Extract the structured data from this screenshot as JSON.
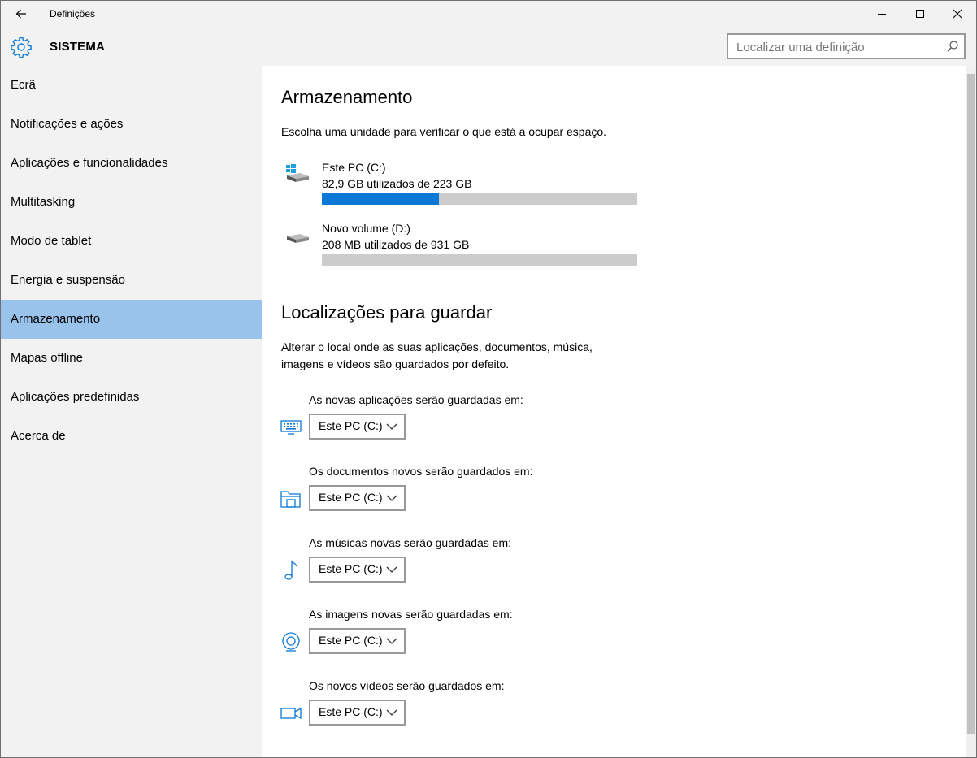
{
  "window": {
    "title": "Definições",
    "controls": [
      "minimize-icon",
      "maximize-icon",
      "close-icon"
    ]
  },
  "header": {
    "section": "SISTEMA",
    "search_placeholder": "Localizar uma definição"
  },
  "sidebar": {
    "items": [
      {
        "label": "Ecrã"
      },
      {
        "label": "Notificações e ações"
      },
      {
        "label": "Aplicações e funcionalidades"
      },
      {
        "label": "Multitasking"
      },
      {
        "label": "Modo de tablet"
      },
      {
        "label": "Energia e suspensão"
      },
      {
        "label": "Armazenamento",
        "active": true
      },
      {
        "label": "Mapas offline"
      },
      {
        "label": "Aplicações predefinidas"
      },
      {
        "label": "Acerca de"
      }
    ]
  },
  "storage": {
    "title": "Armazenamento",
    "subtitle": "Escolha uma unidade para verificar o que está a ocupar espaço.",
    "drives": [
      {
        "name": "Este PC (C:)",
        "usage": "82,9 GB utilizados de 223 GB",
        "fraction": 0.3717
      },
      {
        "name": "Novo volume (D:)",
        "usage": "208 MB utilizados de 931 GB",
        "fraction": 0.0002
      }
    ]
  },
  "locations": {
    "title": "Localizações para guardar",
    "description": "Alterar o local onde as suas aplicações, documentos, música, imagens e vídeos são guardados por defeito.",
    "items": [
      {
        "label": "As novas aplicações serão guardadas em:",
        "value": "Este PC (C:)",
        "icon": "apps-keyboard-icon"
      },
      {
        "label": "Os documentos novos serão guardados em:",
        "value": "Este PC (C:)",
        "icon": "documents-folder-icon"
      },
      {
        "label": "As músicas novas serão guardadas em:",
        "value": "Este PC (C:)",
        "icon": "music-note-icon"
      },
      {
        "label": "As imagens novas serão guardadas em:",
        "value": "Este PC (C:)",
        "icon": "camera-icon"
      },
      {
        "label": "Os novos vídeos serão guardados em:",
        "value": "Este PC (C:)",
        "icon": "video-camera-icon"
      }
    ]
  },
  "colors": {
    "accent": "#0b78d7",
    "sidebar_active": "#99c3ea",
    "chrome": "#f2f2f2",
    "bar_track": "#cccccc"
  }
}
